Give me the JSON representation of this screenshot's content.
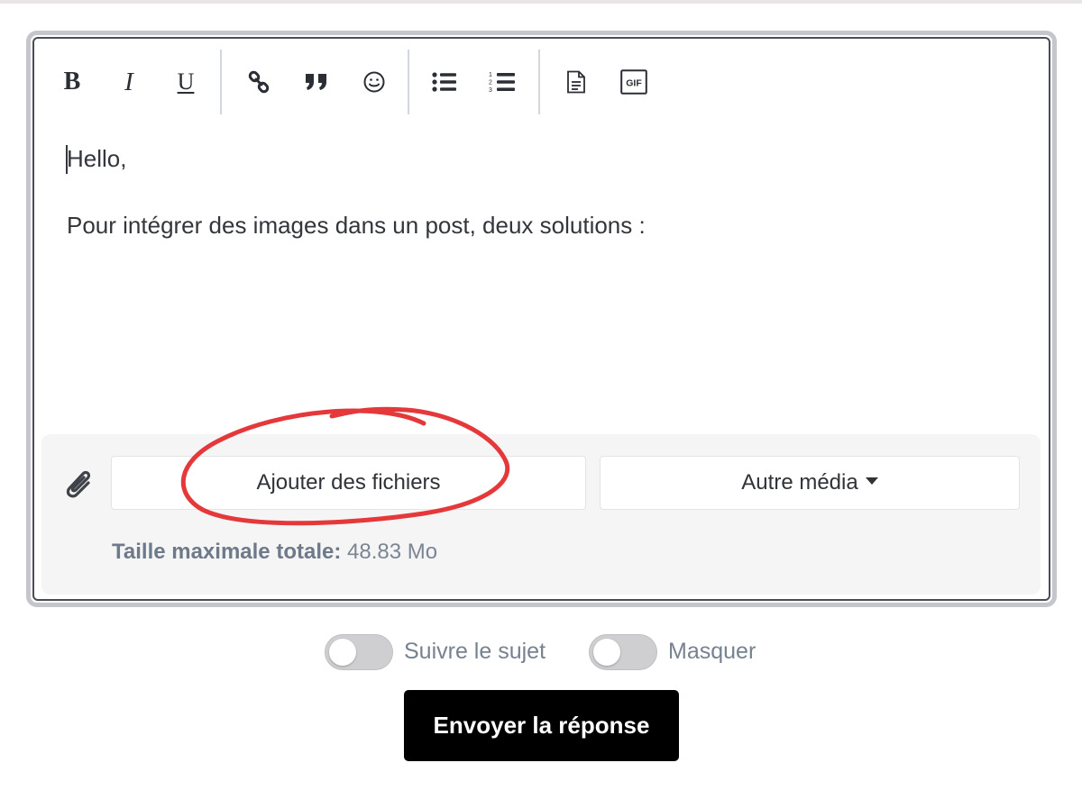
{
  "toolbar": {
    "bold": "B",
    "italic": "I",
    "underline": "U",
    "gif": "GIF",
    "icons": [
      "bold-icon",
      "italic-icon",
      "underline-icon",
      "link-icon",
      "quote-icon",
      "emoji-icon",
      "bullet-list-icon",
      "numbered-list-icon",
      "document-icon",
      "gif-icon"
    ]
  },
  "editor": {
    "lines": [
      "Hello,",
      "Pour intégrer des images dans un post, deux solutions :"
    ]
  },
  "attachments": {
    "add_files_label": "Ajouter des fichiers",
    "other_media_label": "Autre média",
    "max_size_label": "Taille maximale totale:",
    "max_size_value": "48.83 Mo"
  },
  "options": {
    "follow_label": "Suivre le sujet",
    "follow_on": false,
    "hide_label": "Masquer",
    "hide_on": false
  },
  "submit_label": "Envoyer la réponse",
  "colors": {
    "annotation": "#e5383b",
    "submit_bg": "#000000",
    "panel_bg": "#f5f5f5"
  }
}
